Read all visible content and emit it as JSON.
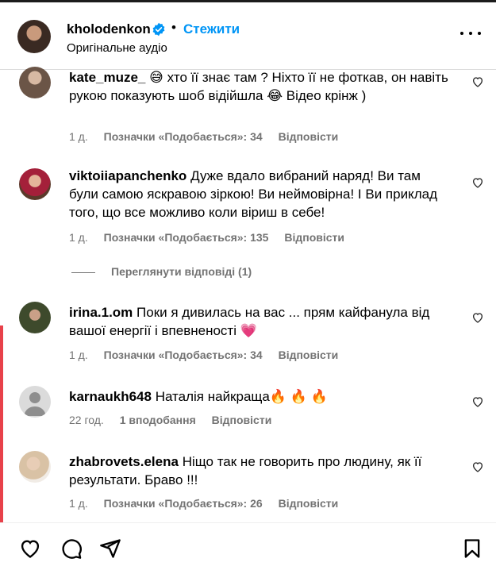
{
  "header": {
    "username": "kholodenkon",
    "separator": "•",
    "follow_label": "Стежити",
    "audio_label": "Оригінальне аудіо"
  },
  "comments": [
    {
      "username": "kate_muze_",
      "text": "😅 хто її знає там ? Ніхто її не фоткав, он навіть рукою показують шоб відійшла 😂 Відео крінж )",
      "time": "1 д.",
      "likes": "Позначки «Подобається»: 34",
      "reply": "Відповісти"
    },
    {
      "username": "viktoiiapanchenko",
      "text": "Дуже вдало вибраний наряд! Ви там були самою яскравою зіркою! Ви неймовірна! І Ви приклад того, що все можливо коли віриш в себе!",
      "time": "1 д.",
      "likes": "Позначки «Подобається»: 135",
      "reply": "Відповісти"
    },
    {
      "username": "irina.1.om",
      "text": "Поки я дивилась на вас ... прям кайфанула від вашої енергії і впевненості 💗",
      "time": "1 д.",
      "likes": "Позначки «Подобається»: 34",
      "reply": "Відповісти"
    },
    {
      "username": "karnaukh648",
      "text": "Наталія найкраща🔥 🔥 🔥",
      "time": "22 год.",
      "likes": "1 вподобання",
      "reply": "Відповісти"
    },
    {
      "username": "zhabrovets.elena",
      "text": "Ніщо так не говорить про людину, як її результати. Браво !!!",
      "time": "1 д.",
      "likes": "Позначки «Подобається»: 26",
      "reply": "Відповісти"
    }
  ],
  "view_replies": "Переглянути відповіді (1)"
}
